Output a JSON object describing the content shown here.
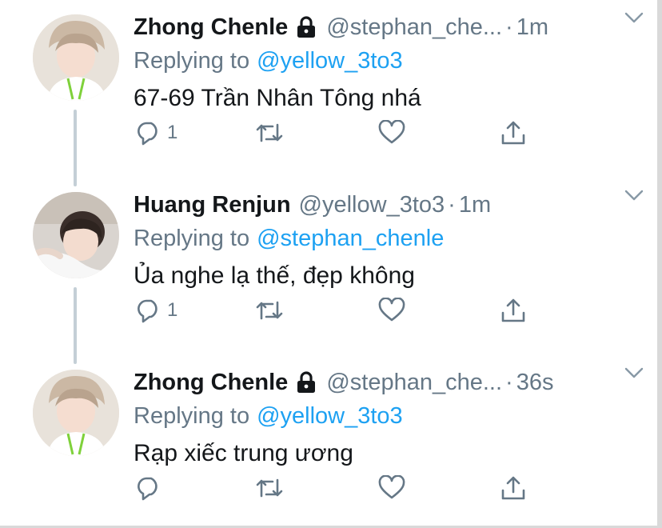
{
  "tweets": [
    {
      "author_name": "Zhong Chenle",
      "protected": true,
      "handle": "@stephan_che...",
      "separator": "·",
      "time": "1m",
      "replying_prefix": "Replying to",
      "replying_to": "@yellow_3to3",
      "text": "67-69 Trần Nhân Tông nhá",
      "reply_count": "1"
    },
    {
      "author_name": "Huang Renjun",
      "protected": false,
      "handle": "@yellow_3to3",
      "separator": "·",
      "time": "1m",
      "replying_prefix": "Replying to",
      "replying_to": "@stephan_chenle",
      "text": "Ủa nghe lạ thế, đẹp không",
      "reply_count": "1"
    },
    {
      "author_name": "Zhong Chenle",
      "protected": true,
      "handle": "@stephan_che...",
      "separator": "·",
      "time": "36s",
      "replying_prefix": "Replying to",
      "replying_to": "@yellow_3to3",
      "text": "Rạp xiếc trung ương",
      "reply_count": ""
    }
  ],
  "icons": {
    "reply": "reply-icon",
    "retweet": "retweet-icon",
    "like": "heart-icon",
    "share": "share-icon",
    "lock": "lock-icon",
    "more": "chevron-down-icon"
  },
  "colors": {
    "name": "#14171a",
    "secondary": "#657786",
    "link": "#1da1f2",
    "thread_line": "#c4cfd6"
  }
}
